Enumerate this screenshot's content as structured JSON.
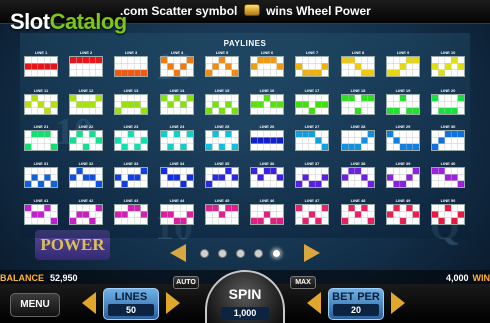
{
  "logo": {
    "part1": "Slot",
    "part2": "Catalog"
  },
  "banner": {
    "prefix": ".com",
    "text1": "Scatter symbol",
    "icon": "wheel-icon",
    "text2": "wins Wheel Power"
  },
  "panel": {
    "title": "PAYLINES"
  },
  "paylines": [
    {
      "label": "LINE 1",
      "color": "#e8141c",
      "rows": [
        1,
        1,
        1,
        1,
        1
      ]
    },
    {
      "label": "LINE 2",
      "color": "#e8141c",
      "rows": [
        0,
        0,
        0,
        0,
        0
      ]
    },
    {
      "label": "LINE 3",
      "color": "#f05a12",
      "rows": [
        2,
        2,
        2,
        2,
        2
      ]
    },
    {
      "label": "LINE 4",
      "color": "#f07a10",
      "rows": [
        0,
        1,
        2,
        1,
        0
      ]
    },
    {
      "label": "LINE 5",
      "color": "#f08c10",
      "rows": [
        2,
        1,
        0,
        1,
        2
      ]
    },
    {
      "label": "LINE 6",
      "color": "#f09a10",
      "rows": [
        1,
        0,
        0,
        0,
        1
      ]
    },
    {
      "label": "LINE 7",
      "color": "#f0b010",
      "rows": [
        1,
        2,
        2,
        2,
        1
      ]
    },
    {
      "label": "LINE 8",
      "color": "#f0c810",
      "rows": [
        0,
        0,
        1,
        2,
        2
      ]
    },
    {
      "label": "LINE 9",
      "color": "#e8d810",
      "rows": [
        2,
        2,
        1,
        0,
        0
      ]
    },
    {
      "label": "LINE 10",
      "color": "#e0e010",
      "rows": [
        1,
        2,
        1,
        0,
        1
      ]
    },
    {
      "label": "LINE 11",
      "color": "#b8e010",
      "rows": [
        1,
        0,
        1,
        2,
        1
      ]
    },
    {
      "label": "LINE 12",
      "color": "#a8e010",
      "rows": [
        0,
        1,
        1,
        1,
        0
      ]
    },
    {
      "label": "LINE 13",
      "color": "#98e010",
      "rows": [
        2,
        1,
        1,
        1,
        2
      ]
    },
    {
      "label": "LINE 14",
      "color": "#88e010",
      "rows": [
        0,
        1,
        0,
        1,
        0
      ]
    },
    {
      "label": "LINE 15",
      "color": "#78e010",
      "rows": [
        2,
        1,
        2,
        1,
        2
      ]
    },
    {
      "label": "LINE 16",
      "color": "#58e010",
      "rows": [
        1,
        1,
        0,
        1,
        1
      ]
    },
    {
      "label": "LINE 17",
      "color": "#40e010",
      "rows": [
        1,
        1,
        2,
        1,
        1
      ]
    },
    {
      "label": "LINE 18",
      "color": "#30e020",
      "rows": [
        0,
        0,
        2,
        0,
        0
      ]
    },
    {
      "label": "LINE 19",
      "color": "#20e030",
      "rows": [
        2,
        2,
        0,
        2,
        2
      ]
    },
    {
      "label": "LINE 20",
      "color": "#18e040",
      "rows": [
        0,
        2,
        2,
        2,
        0
      ]
    },
    {
      "label": "LINE 21",
      "color": "#10e070",
      "rows": [
        2,
        0,
        0,
        0,
        2
      ]
    },
    {
      "label": "LINE 22",
      "color": "#10e090",
      "rows": [
        1,
        0,
        2,
        0,
        1
      ]
    },
    {
      "label": "LINE 23",
      "color": "#10e0b0",
      "rows": [
        1,
        2,
        0,
        2,
        1
      ]
    },
    {
      "label": "LINE 24",
      "color": "#10d0c8",
      "rows": [
        0,
        2,
        0,
        2,
        0
      ]
    },
    {
      "label": "LINE 25",
      "color": "#10c0e0",
      "rows": [
        2,
        0,
        2,
        0,
        2
      ]
    },
    {
      "label": "LINE 26",
      "color": "#1020c8",
      "rows": [
        1,
        1,
        1,
        1,
        1
      ]
    },
    {
      "label": "LINE 27",
      "color": "#10a0e0",
      "rows": [
        0,
        0,
        0,
        1,
        2
      ]
    },
    {
      "label": "LINE 28",
      "color": "#1090e0",
      "rows": [
        2,
        2,
        2,
        1,
        0
      ]
    },
    {
      "label": "LINE 29",
      "color": "#1080e0",
      "rows": [
        0,
        1,
        2,
        2,
        2
      ]
    },
    {
      "label": "LINE 30",
      "color": "#1070e0",
      "rows": [
        2,
        1,
        0,
        0,
        0
      ]
    },
    {
      "label": "LINE 31",
      "color": "#1060e0",
      "rows": [
        2,
        1,
        2,
        1,
        2
      ]
    },
    {
      "label": "LINE 32",
      "color": "#1050e0",
      "rows": [
        1,
        0,
        1,
        1,
        2
      ]
    },
    {
      "label": "LINE 33",
      "color": "#1040e0",
      "rows": [
        1,
        2,
        1,
        1,
        0
      ]
    },
    {
      "label": "LINE 34",
      "color": "#1030e0",
      "rows": [
        0,
        1,
        1,
        2,
        1
      ]
    },
    {
      "label": "LINE 35",
      "color": "#2a28e0",
      "rows": [
        2,
        1,
        1,
        0,
        1
      ]
    },
    {
      "label": "LINE 36",
      "color": "#3a20e0",
      "rows": [
        0,
        1,
        0,
        0,
        1
      ]
    },
    {
      "label": "LINE 37",
      "color": "#5a20e0",
      "rows": [
        2,
        1,
        2,
        2,
        1
      ]
    },
    {
      "label": "LINE 38",
      "color": "#7020e0",
      "rows": [
        1,
        0,
        0,
        1,
        2
      ]
    },
    {
      "label": "LINE 39",
      "color": "#8a20e0",
      "rows": [
        1,
        2,
        2,
        1,
        0
      ]
    },
    {
      "label": "LINE 40",
      "color": "#a020e0",
      "rows": [
        0,
        0,
        1,
        1,
        2
      ]
    },
    {
      "label": "LINE 41",
      "color": "#c020d0",
      "rows": [
        0,
        1,
        1,
        0,
        2
      ]
    },
    {
      "label": "LINE 42",
      "color": "#c820c0",
      "rows": [
        2,
        1,
        1,
        2,
        0
      ]
    },
    {
      "label": "LINE 43",
      "color": "#d020b0",
      "rows": [
        1,
        1,
        0,
        0,
        1
      ]
    },
    {
      "label": "LINE 44",
      "color": "#d820a0",
      "rows": [
        1,
        1,
        2,
        2,
        1
      ]
    },
    {
      "label": "LINE 45",
      "color": "#e02090",
      "rows": [
        0,
        0,
        1,
        0,
        0
      ]
    },
    {
      "label": "LINE 46",
      "color": "#e02080",
      "rows": [
        2,
        2,
        1,
        2,
        2
      ]
    },
    {
      "label": "LINE 47",
      "color": "#e82070",
      "rows": [
        0,
        2,
        1,
        2,
        0
      ]
    },
    {
      "label": "LINE 48",
      "color": "#e82060",
      "rows": [
        2,
        0,
        1,
        0,
        2
      ]
    },
    {
      "label": "LINE 49",
      "color": "#e82050",
      "rows": [
        1,
        0,
        2,
        0,
        1
      ]
    },
    {
      "label": "LINE 50",
      "color": "#e81840",
      "rows": [
        1,
        2,
        0,
        2,
        1
      ]
    }
  ],
  "carousel": {
    "pages": 5,
    "active": 4
  },
  "balance": {
    "label": "BALANCE",
    "value": "52,950"
  },
  "win": {
    "value": "4,000",
    "label": "WIN"
  },
  "menu": {
    "label": "MENU"
  },
  "lines": {
    "label": "LINES",
    "value": "50"
  },
  "spin": {
    "label": "SPIN",
    "value": "1,000"
  },
  "auto": {
    "label": "AUTO"
  },
  "max": {
    "label": "MAX"
  },
  "bet": {
    "label": "BET PER",
    "value": "20"
  }
}
